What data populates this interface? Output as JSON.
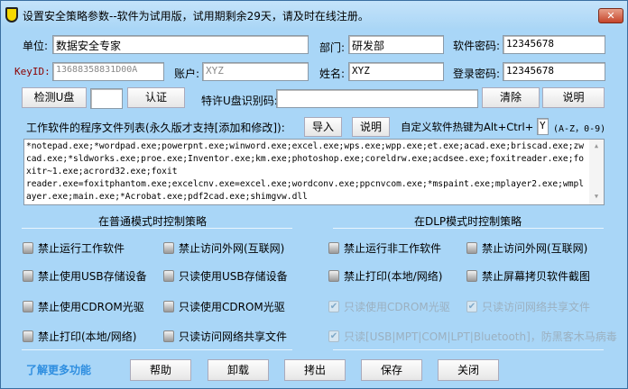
{
  "window": {
    "title": "设置安全策略参数--软件为试用版，试用期剩余29天，请及时在线注册。",
    "close": "✕"
  },
  "fields": {
    "unit_label": "单位:",
    "unit": "数据安全专家",
    "dept_label": "部门:",
    "dept": "研发部",
    "softpw_label": "软件密码:",
    "softpw": "12345678",
    "keyid_label": "KeyID:",
    "keyid": "13688358831D00A",
    "account_label": "账户:",
    "account": "XYZ",
    "name_label": "姓名:",
    "name": "XYZ",
    "loginpw_label": "登录密码:",
    "loginpw": "12345678",
    "usb_code_label": "特许U盘识别码:",
    "usb_code": "",
    "usb_small": "",
    "hotkey_label": "自定义软件热键为Alt+Ctrl+",
    "hotkey": "Y",
    "hotkey_hint": "(A-Z，0-9)"
  },
  "buttons": {
    "detect": "检测U盘",
    "auth": "认证",
    "clear": "清除",
    "explain1": "说明",
    "import": "导入",
    "explain2": "说明"
  },
  "program_list": {
    "label": "工作软件的程序文件列表(永久版才支持[添加和修改]):",
    "text": "*notepad.exe;*wordpad.exe;powerpnt.exe;winword.exe;excel.exe;wps.exe;wpp.exe;et.exe;acad.exe;briscad.exe;zwcad.exe;*sldworks.exe;proe.exe;Inventor.exe;km.exe;photoshop.exe;coreldrw.exe;acdsee.exe;foxitreader.exe;foxitr~1.exe;acrord32.exe;foxit\nreader.exe=foxitphantom.exe;excelcnv.exe=excel.exe;wordconv.exe;ppcnvcom.exe;*mspaint.exe;mplayer2.exe;wmplayer.exe;main.exe;*Acrobat.exe;pdf2cad.exe;shimgvw.dll"
  },
  "normal": {
    "heading": "在普通模式时控制策略",
    "items": [
      {
        "label": "禁止运行工作软件",
        "checked": false
      },
      {
        "label": "禁止访问外网(互联网)",
        "checked": false
      },
      {
        "label": "禁止使用USB存储设备",
        "checked": false
      },
      {
        "label": "只读使用USB存储设备",
        "checked": false
      },
      {
        "label": "禁止使用CDROM光驱",
        "checked": false
      },
      {
        "label": "只读使用CDROM光驱",
        "checked": false
      },
      {
        "label": "禁止打印(本地/网络)",
        "checked": false
      },
      {
        "label": "只读访问网络共享文件",
        "checked": false
      }
    ]
  },
  "dlp": {
    "heading": "在DLP模式时控制策略",
    "items": [
      {
        "label": "禁止运行非工作软件",
        "checked": false
      },
      {
        "label": "禁止访问外网(互联网)",
        "checked": false
      },
      {
        "label": "禁止打印(本地/网络)",
        "checked": false
      },
      {
        "label": "禁止屏幕拷贝软件截图",
        "checked": false
      },
      {
        "label": "只读使用CDROM光驱",
        "checked": true
      },
      {
        "label": "只读访问网络共享文件",
        "checked": true
      },
      {
        "label": "只读[USB|MPT|COM|LPT|Bluetooth]，防黑客木马病毒",
        "checked": true
      }
    ]
  },
  "footer": {
    "more": "了解更多功能",
    "help": "帮助",
    "uninstall": "卸载",
    "export": "拷出",
    "save": "保存",
    "close": "关闭"
  }
}
